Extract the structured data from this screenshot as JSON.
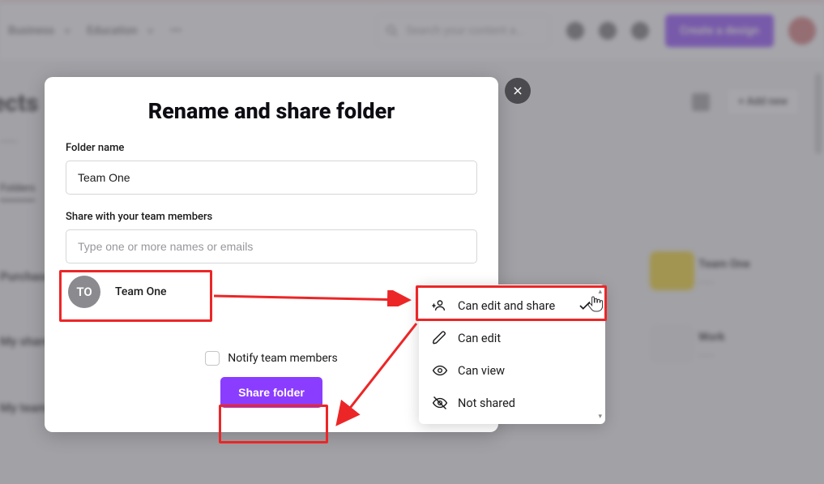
{
  "bg": {
    "nav": [
      "Business",
      "Education",
      "•••"
    ],
    "search_placeholder": "Search your content a...",
    "create_design": "Create a design",
    "page_title": "ects",
    "sub": "____",
    "tab": "Folders",
    "sections": [
      "Purchase",
      "My share",
      "My team"
    ],
    "add_item": "+   Add new",
    "card1": {
      "title": "Team One",
      "sub": "____"
    },
    "card2": {
      "title": "Work",
      "sub": "____"
    }
  },
  "modal": {
    "title": "Rename and share folder",
    "folder_name_label": "Folder name",
    "folder_name_value": "Team One",
    "share_label": "Share with your team members",
    "share_placeholder": "Type one or more names or emails",
    "team_badge": "TO",
    "team_name": "Team One",
    "notify_label": "Notify team members",
    "share_button": "Share folder"
  },
  "dropdown": {
    "items": [
      {
        "label": "Can edit and share",
        "icon": "add-user-icon",
        "selected": true
      },
      {
        "label": "Can edit",
        "icon": "pencil-icon",
        "selected": false
      },
      {
        "label": "Can view",
        "icon": "eye-icon",
        "selected": false
      },
      {
        "label": "Not shared",
        "icon": "eye-off-icon",
        "selected": false
      }
    ]
  },
  "colors": {
    "accent": "#8b3dff",
    "anno": "#ec2627"
  }
}
